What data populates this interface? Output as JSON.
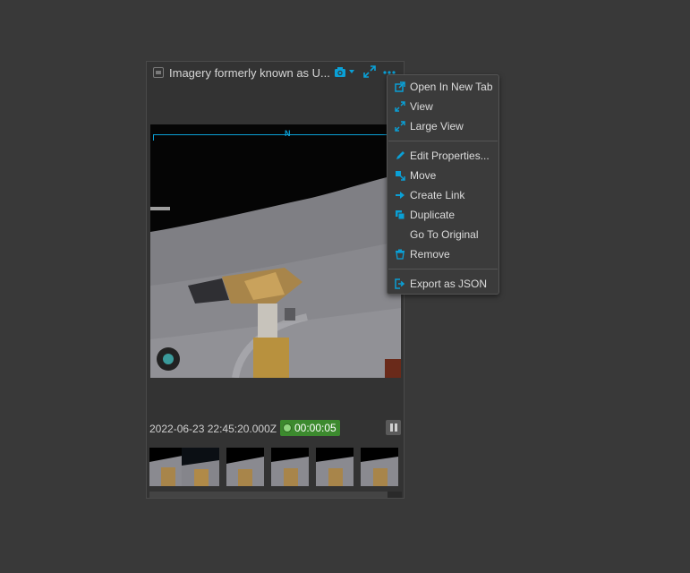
{
  "panel": {
    "title": "Imagery formerly known as U...",
    "timestamp": "2022-06-23 22:45:20.000Z",
    "duration": "00:00:05",
    "compass_label": "N"
  },
  "menu": {
    "items": [
      {
        "label": "Open In New Tab",
        "icon": "open-new-tab-icon"
      },
      {
        "label": "View",
        "icon": "expand-icon"
      },
      {
        "label": "Large View",
        "icon": "large-expand-icon"
      },
      {
        "label": "Edit Properties...",
        "icon": "pencil-icon"
      },
      {
        "label": "Move",
        "icon": "move-icon"
      },
      {
        "label": "Create Link",
        "icon": "link-arrow-icon"
      },
      {
        "label": "Duplicate",
        "icon": "duplicate-icon"
      },
      {
        "label": "Go To Original",
        "icon": ""
      },
      {
        "label": "Remove",
        "icon": "trash-icon"
      },
      {
        "label": "Export as JSON",
        "icon": "export-icon"
      }
    ]
  },
  "colors": {
    "accent": "#0aa0d6",
    "badge": "#3c8a2e",
    "background": "#393939"
  }
}
